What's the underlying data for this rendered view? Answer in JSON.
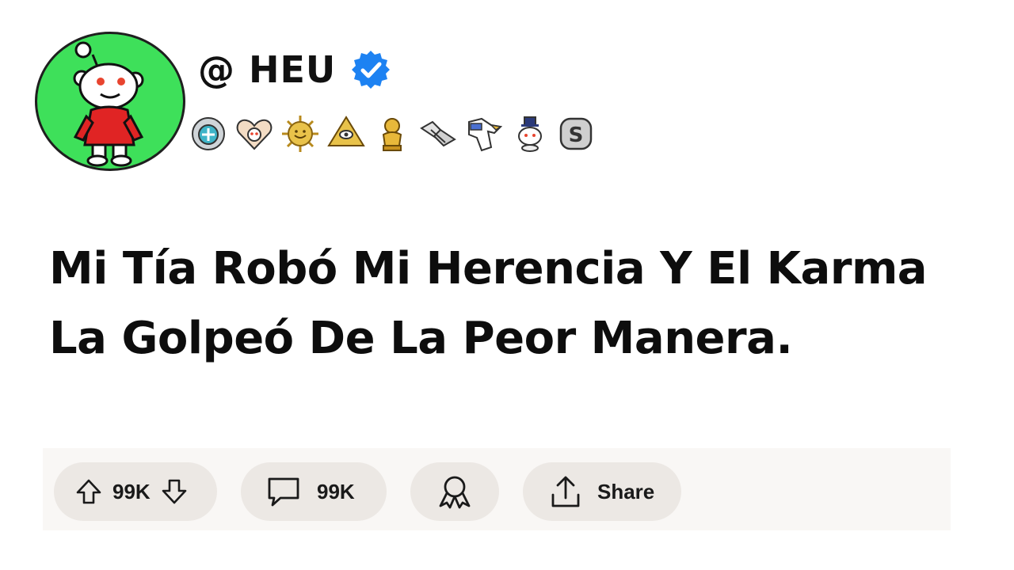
{
  "post": {
    "author": {
      "handle": "@ HEU",
      "verified": true,
      "avatar_background": "#3ee05a",
      "verified_color": "#1d82f2",
      "badges": [
        {
          "icon": "robot-helmet-badge-icon"
        },
        {
          "icon": "heart-snoo-badge-icon"
        },
        {
          "icon": "sun-badge-icon"
        },
        {
          "icon": "pyramid-eye-badge-icon"
        },
        {
          "icon": "gold-trophy-snoo-badge-icon"
        },
        {
          "icon": "handshake-badge-icon"
        },
        {
          "icon": "eagle-badge-icon"
        },
        {
          "icon": "top-hat-snoo-badge-icon"
        },
        {
          "icon": "silver-s-coin-badge-icon"
        }
      ]
    },
    "title": "Mi Tía Robó Mi Herencia Y El Karma La Golpeó De La Peor Manera.",
    "actions": {
      "upvote_icon": "arrow-up-icon",
      "vote_count": "99K",
      "downvote_icon": "arrow-down-icon",
      "comment_icon": "speech-bubble-icon",
      "comment_count": "99K",
      "award_icon": "award-ribbon-icon",
      "share_icon": "share-arrow-icon",
      "share_label": "Share"
    }
  }
}
